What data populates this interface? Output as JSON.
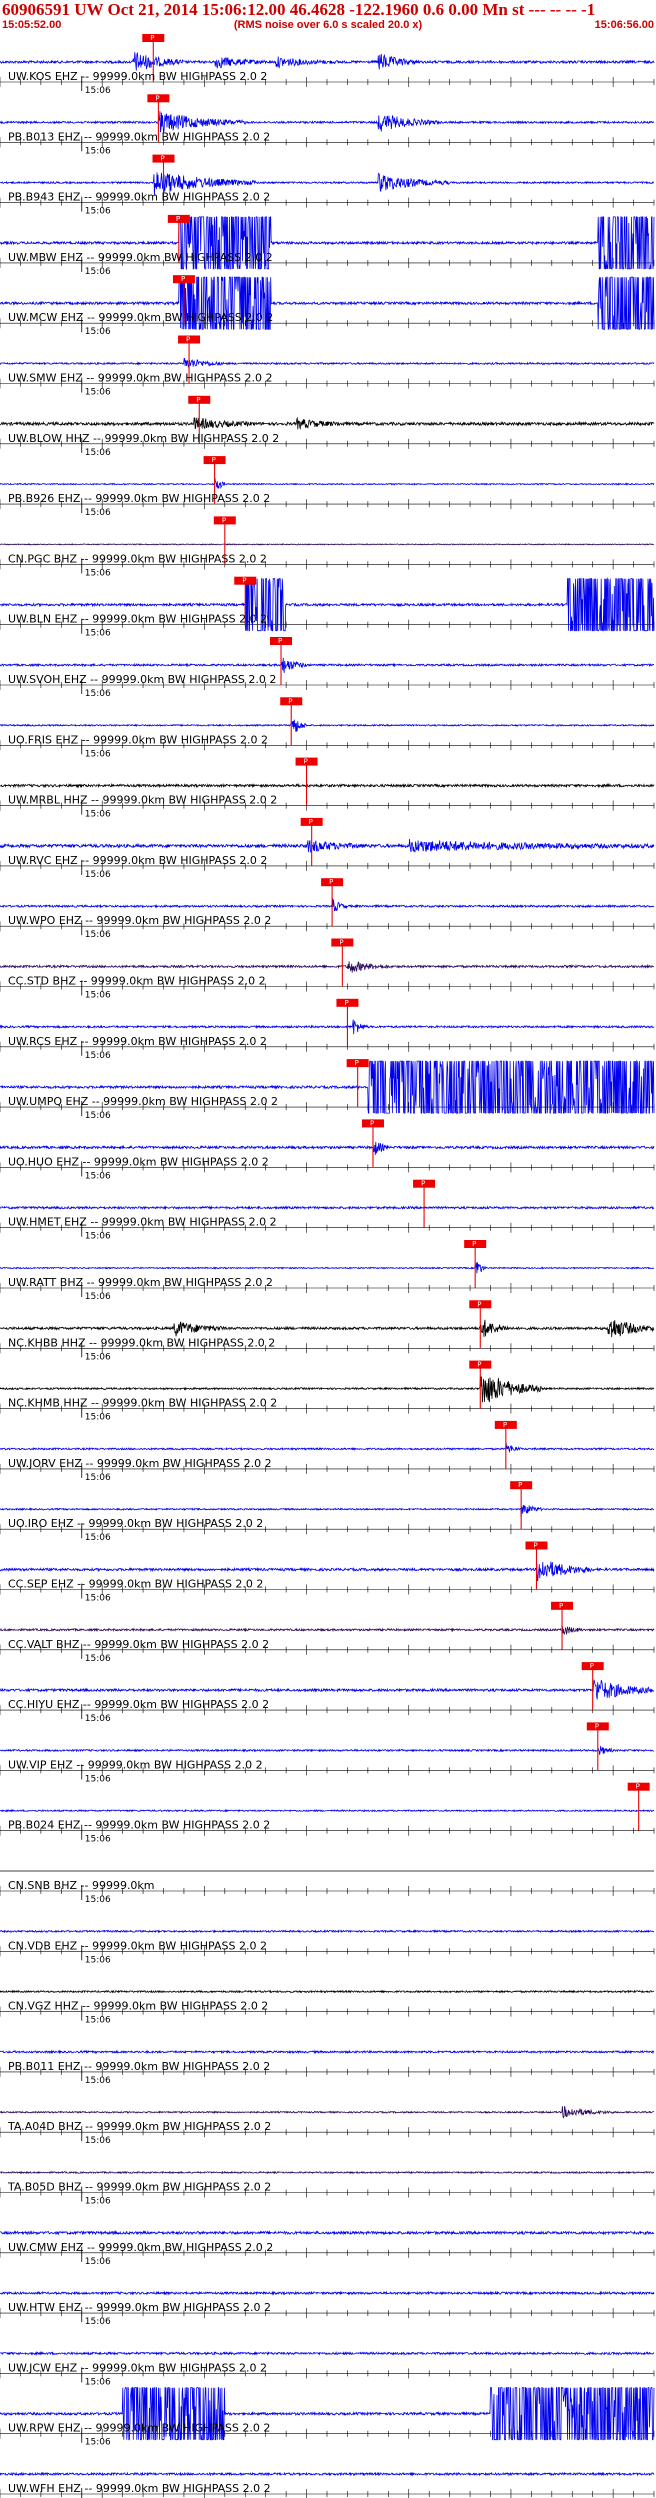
{
  "header": {
    "title": "60906591 UW Oct 21, 2014 15:06:12.00   46.4628 -122.1960  0.6 0.00 Mn st --- -- --  -1",
    "start_time": "15:05:52.00",
    "note": "(RMS noise over 6.0 s scaled 20.0 x)",
    "end_time": "15:06:56.00"
  },
  "minute_marker": "15:06",
  "colors": {
    "trace_blue": "#0000ee",
    "trace_black": "#000000",
    "trace_purple": "#2a0a5a",
    "pick_red": "#ee0000",
    "header_red": "#cc0000"
  },
  "chart_data": {
    "type": "seismogram",
    "time_range": [
      "15:05:52.00",
      "15:06:56.00"
    ],
    "tick_interval_s": 2,
    "channels": [
      {
        "label": "UW.KOS EHZ -- 99999.0km BW  HIGHPASS  2.0  2",
        "color": "blue",
        "pick_s": 15.0,
        "pick_label": "P",
        "bursts": [
          [
            13,
            18,
            3.5
          ],
          [
            21,
            26,
            2.0
          ],
          [
            27,
            33,
            1.6
          ],
          [
            37,
            41,
            2.8
          ]
        ],
        "noise": 1.0
      },
      {
        "label": "PB.B013 EHZ -- 99999.0km BW  HIGHPASS  2.0  2",
        "color": "blue",
        "pick_s": 15.5,
        "pick_label": "P",
        "bursts": [
          [
            15.5,
            24,
            3.5
          ],
          [
            37,
            43,
            3.0
          ]
        ],
        "noise": 0.8
      },
      {
        "label": "PB.B943 EHZ -- 99999.0km BW  HIGHPASS  2.0  2",
        "color": "blue",
        "pick_s": 16.0,
        "pick_label": "P",
        "bursts": [
          [
            15,
            25,
            4.0
          ],
          [
            37,
            44,
            3.0
          ]
        ],
        "noise": 0.7
      },
      {
        "label": "UW.MBW EHZ -- 99999.0km BW  HIGHPASS  2.0  2",
        "color": "blue",
        "pick_s": 17.5,
        "pick_label": "P",
        "bursts": [
          [
            17.5,
            26.5,
            30
          ],
          [
            58.5,
            64,
            30
          ]
        ],
        "noise": 1.0
      },
      {
        "label": "UW.MCW EHZ -- 99999.0km BW  HIGHPASS  2.0  2",
        "color": "blue",
        "pick_s": 18.0,
        "pick_label": "P",
        "bursts": [
          [
            17.5,
            26.5,
            30
          ],
          [
            58.5,
            64,
            30
          ]
        ],
        "noise": 1.0
      },
      {
        "label": "UW.SMW EHZ -- 99999.0km BW  HIGHPASS  2.0  2",
        "color": "blue",
        "pick_s": 18.5,
        "pick_label": "P",
        "bursts": [
          [
            18,
            22,
            2.0
          ]
        ],
        "noise": 0.7
      },
      {
        "label": "UW.BLOW HHZ -- 99999.0km BW  HIGHPASS  2.0  2",
        "color": "black",
        "pick_s": 19.5,
        "pick_label": "P",
        "bursts": [
          [
            19,
            25,
            1.8
          ],
          [
            29,
            34,
            1.5
          ]
        ],
        "noise": 1.2
      },
      {
        "label": "PB.B926 EHZ -- 99999.0km BW  HIGHPASS  2.0  2",
        "color": "blue",
        "pick_s": 21.0,
        "pick_label": "P",
        "bursts": [
          [
            21,
            22,
            3.5
          ]
        ],
        "noise": 0.5
      },
      {
        "label": "CN.PGC BHZ -- 99999.0km BW  HIGHPASS  2.0  2",
        "color": "purple",
        "pick_s": 22.0,
        "pick_label": "P",
        "bursts": [],
        "noise": 0.4
      },
      {
        "label": "UW.BLN EHZ -- 99999.0km BW  HIGHPASS  2.0  2",
        "color": "blue",
        "pick_s": 24.0,
        "pick_label": "P",
        "bursts": [
          [
            24,
            28,
            30
          ],
          [
            55.5,
            64,
            30
          ]
        ],
        "noise": 1.0
      },
      {
        "label": "UW.SVOH EHZ -- 99999.0km BW  HIGHPASS  2.0  2",
        "color": "blue",
        "pick_s": 27.5,
        "pick_label": "P",
        "bursts": [
          [
            27.5,
            30,
            3.0
          ]
        ],
        "noise": 0.8
      },
      {
        "label": "UO.FRIS EHZ -- 99999.0km BW  HIGHPASS  2.0  2",
        "color": "blue",
        "pick_s": 28.5,
        "pick_label": "P",
        "bursts": [
          [
            28.5,
            30,
            4.0
          ]
        ],
        "noise": 0.6
      },
      {
        "label": "UW.MRBL HHZ -- 99999.0km BW  HIGHPASS  2.0  2",
        "color": "black",
        "pick_s": 30.0,
        "pick_label": "P",
        "bursts": [],
        "noise": 1.0
      },
      {
        "label": "UW.RVC EHZ -- 99999.0km BW  HIGHPASS  2.0  2",
        "color": "blue",
        "pick_s": 30.5,
        "pick_label": "P",
        "bursts": [
          [
            30,
            36,
            2.0
          ],
          [
            40,
            64,
            1.8
          ]
        ],
        "noise": 1.3
      },
      {
        "label": "UW.WPO EHZ -- 99999.0km BW  HIGHPASS  2.0  2",
        "color": "blue",
        "pick_s": 32.5,
        "pick_label": "P",
        "bursts": [
          [
            32.5,
            34,
            2.5
          ]
        ],
        "noise": 0.8
      },
      {
        "label": "CC.STD BHZ -- 99999.0km BW  HIGHPASS  2.0  2",
        "color": "purple",
        "pick_s": 33.5,
        "pick_label": "P",
        "bursts": [
          [
            34,
            38,
            2.2
          ]
        ],
        "noise": 0.9
      },
      {
        "label": "UW.RCS EHZ -- 99999.0km BW  HIGHPASS  2.0  2",
        "color": "blue",
        "pick_s": 34.0,
        "pick_label": "P",
        "bursts": [
          [
            34.5,
            36,
            3.0
          ]
        ],
        "noise": 0.8
      },
      {
        "label": "UW.UMPQ EHZ -- 99999.0km BW  HIGHPASS  2.0  2",
        "color": "blue",
        "pick_s": 35.0,
        "pick_label": "P",
        "bursts": [
          [
            36,
            64,
            30
          ]
        ],
        "noise": 1.0
      },
      {
        "label": "UO.HUO EHZ -- 99999.0km BW  HIGHPASS  2.0  2",
        "color": "blue",
        "pick_s": 36.5,
        "pick_label": "P",
        "bursts": [
          [
            36.5,
            38,
            3.0
          ]
        ],
        "noise": 1.0
      },
      {
        "label": "UW.HMET EHZ -- 99999.0km BW  HIGHPASS  2.0  2",
        "color": "blue",
        "pick_s": 41.5,
        "pick_label": "P",
        "bursts": [],
        "noise": 0.9
      },
      {
        "label": "UW.RATT BHZ -- 99999.0km BW  HIGHPASS  2.0  2",
        "color": "blue",
        "pick_s": 46.5,
        "pick_label": "P",
        "bursts": [
          [
            46.5,
            47.5,
            4.0
          ]
        ],
        "noise": 0.5
      },
      {
        "label": "NC.KHBB HHZ -- 99999.0km BW  HIGHPASS  2.0  2",
        "color": "black",
        "pick_s": 47.0,
        "pick_label": "P",
        "bursts": [
          [
            17,
            22,
            2.5
          ],
          [
            47,
            50,
            3.5
          ],
          [
            59.5,
            64,
            4.0
          ]
        ],
        "noise": 1.0
      },
      {
        "label": "NC.KHMB HHZ -- 99999.0km BW  HIGHPASS  2.0  2",
        "color": "black",
        "pick_s": 47.0,
        "pick_label": "P",
        "bursts": [
          [
            47,
            53,
            6.0
          ]
        ],
        "noise": 0.7
      },
      {
        "label": "UW.JORV EHZ -- 99999.0km BW  HIGHPASS  2.0  2",
        "color": "blue",
        "pick_s": 49.5,
        "pick_label": "P",
        "bursts": [
          [
            49.5,
            51,
            2.0
          ]
        ],
        "noise": 0.7
      },
      {
        "label": "UO.IRO EHZ -- 99999.0km BW  HIGHPASS  2.0  2",
        "color": "blue",
        "pick_s": 51.0,
        "pick_label": "P",
        "bursts": [
          [
            51,
            53,
            2.5
          ]
        ],
        "noise": 0.6
      },
      {
        "label": "CC.SEP EHZ -- 99999.0km BW  HIGHPASS  2.0  2",
        "color": "blue",
        "pick_s": 52.5,
        "pick_label": "P",
        "bursts": [
          [
            52.5,
            58,
            4.0
          ]
        ],
        "noise": 1.0
      },
      {
        "label": "CC.VALT BHZ -- 99999.0km BW  HIGHPASS  2.0  2",
        "color": "purple",
        "pick_s": 55.0,
        "pick_label": "P",
        "bursts": [
          [
            55,
            57,
            1.8
          ]
        ],
        "noise": 0.8
      },
      {
        "label": "CC.HIYU EHZ -- 99999.0km BW  HIGHPASS  2.0  2",
        "color": "blue",
        "pick_s": 58.0,
        "pick_label": "P",
        "bursts": [
          [
            58,
            64,
            4.0
          ]
        ],
        "noise": 1.0
      },
      {
        "label": "UW.VIP EHZ -- 99999.0km BW  HIGHPASS  2.0  2",
        "color": "blue",
        "pick_s": 58.5,
        "pick_label": "P",
        "bursts": [
          [
            58.5,
            60,
            2.0
          ]
        ],
        "noise": 0.7
      },
      {
        "label": "PB.B024 EHZ -- 99999.0km BW  HIGHPASS  2.0  2",
        "color": "blue",
        "pick_s": 62.5,
        "pick_label": "P",
        "bursts": [],
        "noise": 0.6
      },
      {
        "label": "CN.SNB BHZ -- 99999.0km",
        "color": "black",
        "pick_s": null,
        "pick_label": "",
        "bursts": [],
        "noise": 0.0
      },
      {
        "label": "CN.VDB EHZ -- 99999.0km BW  HIGHPASS  2.0  2",
        "color": "blue",
        "pick_s": null,
        "pick_label": "",
        "bursts": [],
        "noise": 0.7
      },
      {
        "label": "CN.VGZ HHZ -- 99999.0km BW  HIGHPASS  2.0  2",
        "color": "black",
        "pick_s": null,
        "pick_label": "",
        "bursts": [],
        "noise": 0.7
      },
      {
        "label": "PB.B011 EHZ -- 99999.0km BW  HIGHPASS  2.0  2",
        "color": "blue",
        "pick_s": null,
        "pick_label": "",
        "bursts": [],
        "noise": 0.8
      },
      {
        "label": "TA.A04D BHZ -- 99999.0km BW  HIGHPASS  2.0  2",
        "color": "purple",
        "pick_s": null,
        "pick_label": "",
        "bursts": [
          [
            55,
            60,
            1.8
          ]
        ],
        "noise": 0.6
      },
      {
        "label": "TA.B05D BHZ -- 99999.0km BW  HIGHPASS  2.0  2",
        "color": "purple",
        "pick_s": null,
        "pick_label": "",
        "bursts": [],
        "noise": 0.6
      },
      {
        "label": "UW.CMW EHZ -- 99999.0km BW  HIGHPASS  2.0  2",
        "color": "blue",
        "pick_s": null,
        "pick_label": "",
        "bursts": [],
        "noise": 1.1
      },
      {
        "label": "UW.HTW EHZ -- 99999.0km BW  HIGHPASS  2.0  2",
        "color": "blue",
        "pick_s": null,
        "pick_label": "",
        "bursts": [],
        "noise": 0.9
      },
      {
        "label": "UW.JCW EHZ -- 99999.0km BW  HIGHPASS  2.0  2",
        "color": "blue",
        "pick_s": null,
        "pick_label": "",
        "bursts": [],
        "noise": 0.9
      },
      {
        "label": "UW.RPW EHZ -- 99999.0km BW  HIGHPASS  2.0  2",
        "color": "blue",
        "pick_s": null,
        "pick_label": "",
        "bursts": [
          [
            12,
            22,
            30
          ],
          [
            48,
            64,
            30
          ]
        ],
        "noise": 1.0
      },
      {
        "label": "UW.WFH EHZ -- 99999.0km BW  HIGHPASS  2.0  2",
        "color": "blue",
        "pick_s": null,
        "pick_label": "",
        "bursts": [],
        "noise": 0.9
      }
    ]
  }
}
